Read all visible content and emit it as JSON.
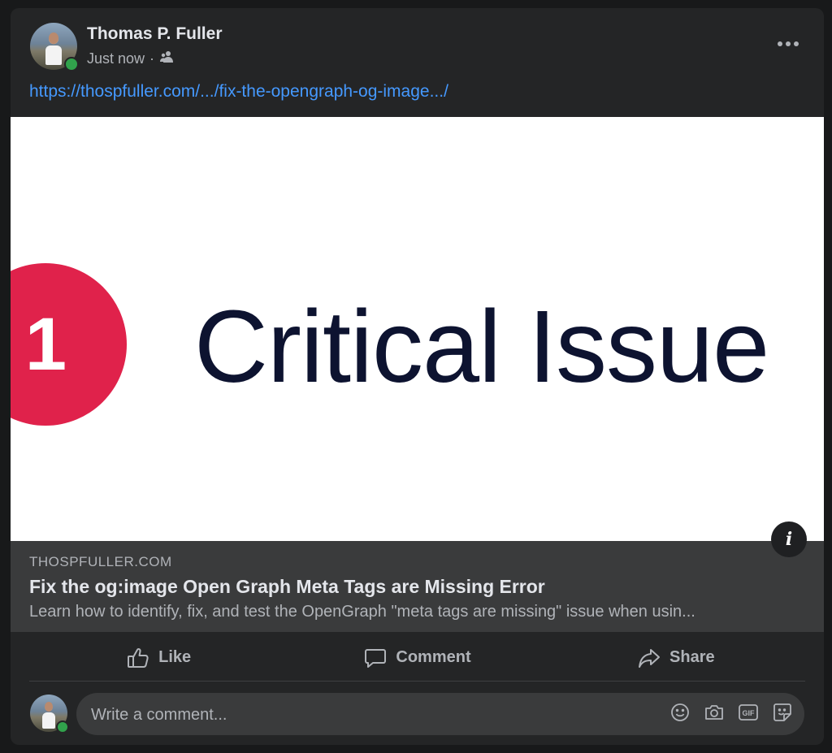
{
  "post": {
    "author": "Thomas P. Fuller",
    "timestamp": "Just now",
    "separator": "·",
    "audience_icon": "friends-icon",
    "link_url": "https://thospfuller.com/.../fix-the-opengraph-og-image.../"
  },
  "preview": {
    "badge_number": "1",
    "headline": "Critical Issue",
    "badge_color": "#e0224b",
    "text_color": "#0d1330"
  },
  "link_card": {
    "domain": "THOSPFULLER.COM",
    "title": "Fix the og:image Open Graph Meta Tags are Missing Error",
    "description": "Learn how to identify, fix, and test the OpenGraph \"meta tags are missing\" issue when usin..."
  },
  "actions": {
    "like": "Like",
    "comment": "Comment",
    "share": "Share"
  },
  "comment": {
    "placeholder": "Write a comment...",
    "icons": [
      "emoji-icon",
      "camera-icon",
      "gif-icon",
      "sticker-icon"
    ]
  },
  "colors": {
    "background": "#18191a",
    "card": "#242526",
    "link": "#4599ff",
    "online": "#31a24c"
  }
}
